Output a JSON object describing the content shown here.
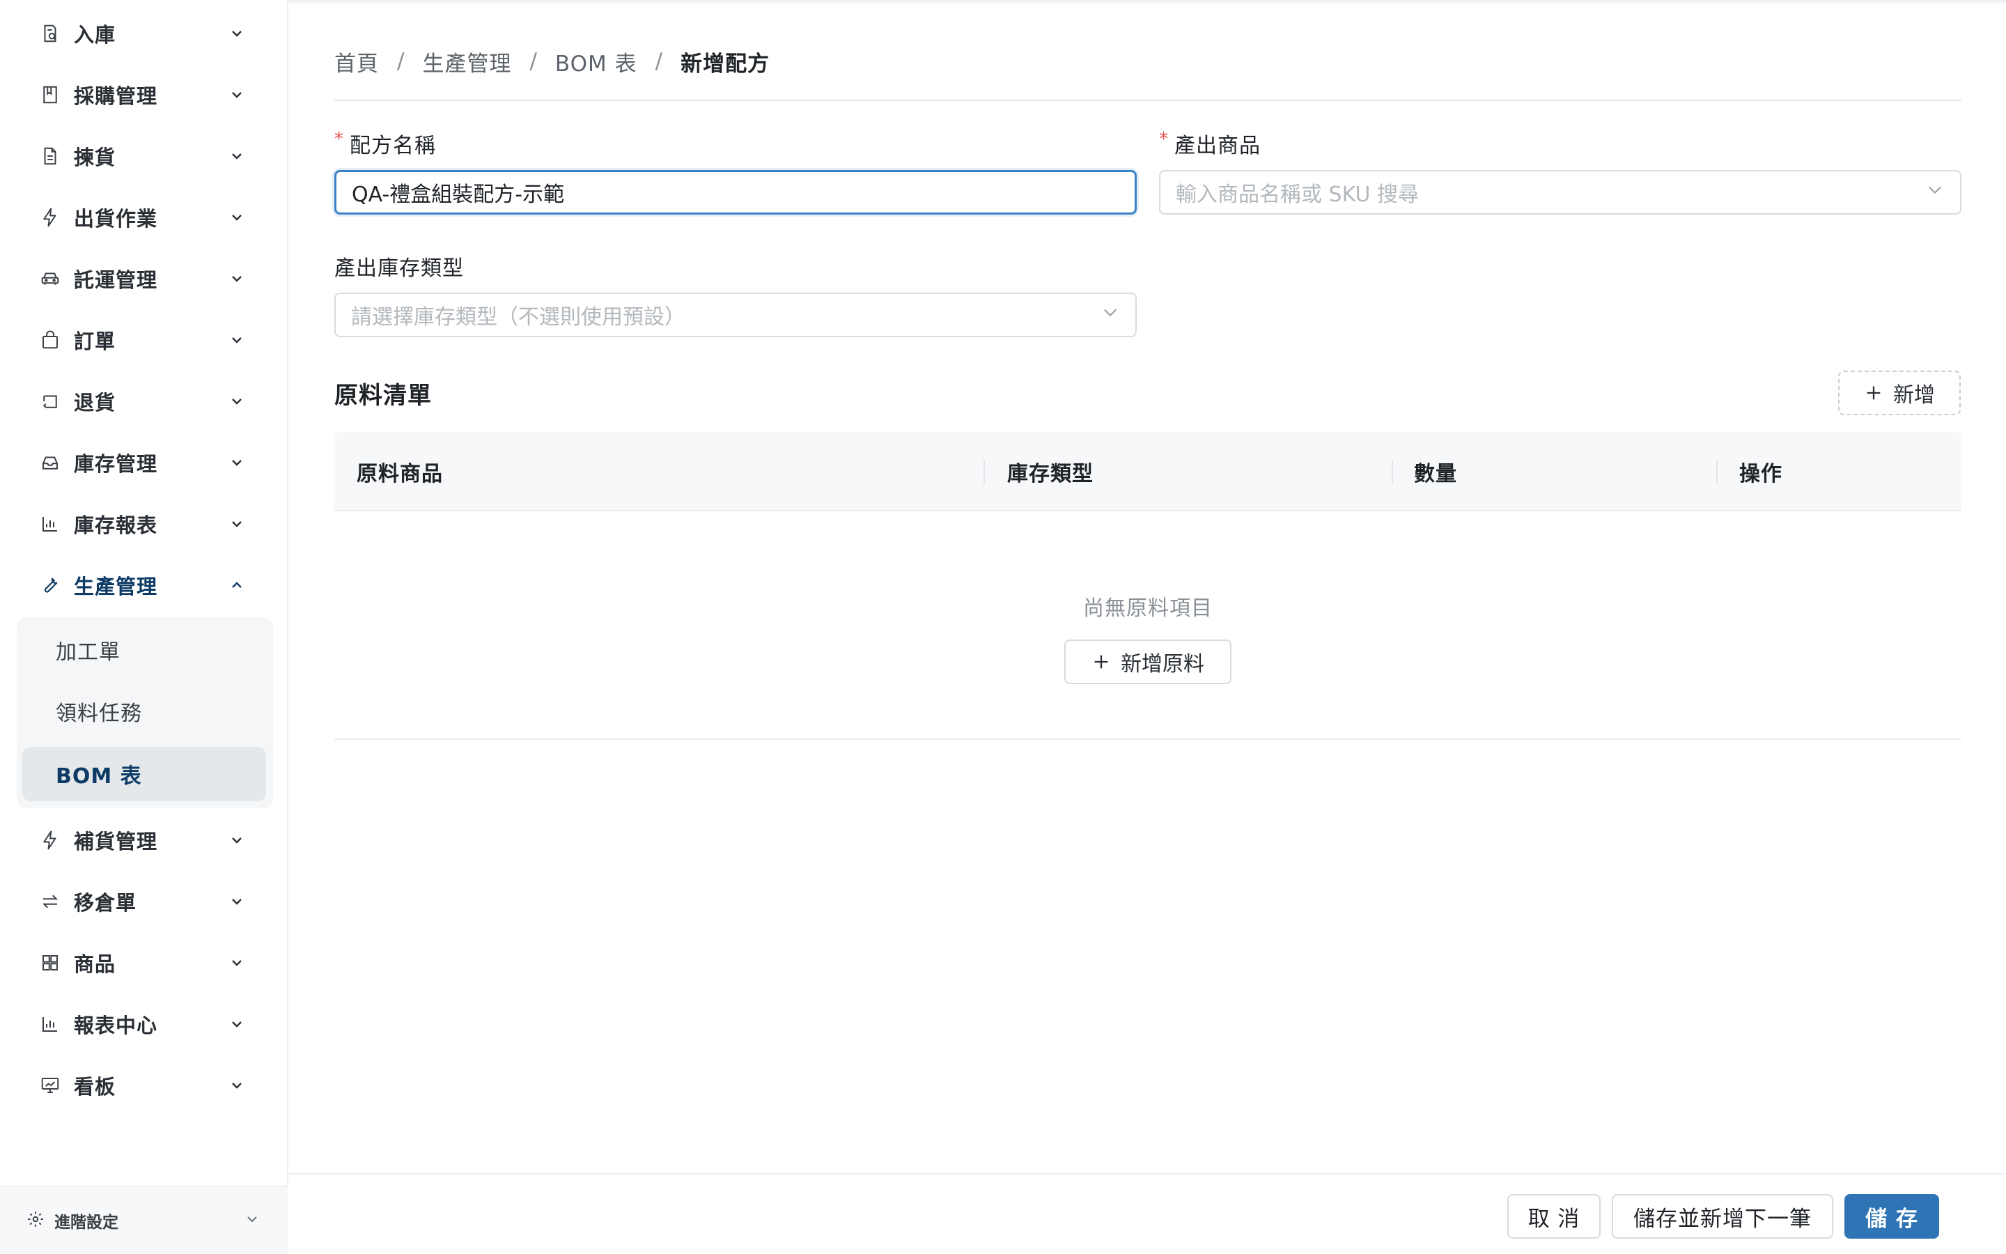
{
  "sidebar": {
    "items": [
      {
        "label": "入庫",
        "icon": "inbound-receipt-icon"
      },
      {
        "label": "採購管理",
        "icon": "book-icon"
      },
      {
        "label": "揀貨",
        "icon": "document-icon"
      },
      {
        "label": "出貨作業",
        "icon": "lightning-icon"
      },
      {
        "label": "託運管理",
        "icon": "car-icon"
      },
      {
        "label": "訂單",
        "icon": "shopping-bag-icon"
      },
      {
        "label": "退貨",
        "icon": "return-icon"
      },
      {
        "label": "庫存管理",
        "icon": "inbox-icon"
      },
      {
        "label": "庫存報表",
        "icon": "bar-chart-icon"
      },
      {
        "label": "生產管理",
        "icon": "wrench-icon"
      },
      {
        "label": "補貨管理",
        "icon": "lightning-icon"
      },
      {
        "label": "移倉單",
        "icon": "swap-icon"
      },
      {
        "label": "商品",
        "icon": "grid-icon"
      },
      {
        "label": "報表中心",
        "icon": "bar-chart-icon"
      },
      {
        "label": "看板",
        "icon": "dashboard-icon"
      }
    ],
    "active_item": "生產管理",
    "submenu": [
      {
        "label": "加工單"
      },
      {
        "label": "領料任務"
      },
      {
        "label": "BOM 表"
      }
    ],
    "selected_subitem": "BOM 表",
    "footer_label": "進階設定"
  },
  "breadcrumb": {
    "items": [
      "首頁",
      "生產管理",
      "BOM 表"
    ],
    "current": "新增配方",
    "separator": "/"
  },
  "form": {
    "recipe_name": {
      "label": "配方名稱",
      "required_mark": "*",
      "value": "QA-禮盒組裝配方-示範"
    },
    "output_product": {
      "label": "產出商品",
      "required_mark": "*",
      "placeholder": "輸入商品名稱或 SKU 搜尋"
    },
    "output_stock_type": {
      "label": "產出庫存類型",
      "placeholder": "請選擇庫存類型（不選則使用預設）"
    }
  },
  "materials": {
    "title": "原料清單",
    "add_label": "新增",
    "columns": [
      "原料商品",
      "庫存類型",
      "數量",
      "操作"
    ],
    "rows": [],
    "empty_text": "尚無原料項目",
    "add_material_label": "新增原料"
  },
  "footer": {
    "cancel_label": "取 消",
    "save_next_label": "儲存並新增下一筆",
    "save_label": "儲 存"
  },
  "colors": {
    "accent": "#2f74b5",
    "active_text": "#0d3b66",
    "required": "#e5484d",
    "focus_border": "#3b82c4"
  }
}
